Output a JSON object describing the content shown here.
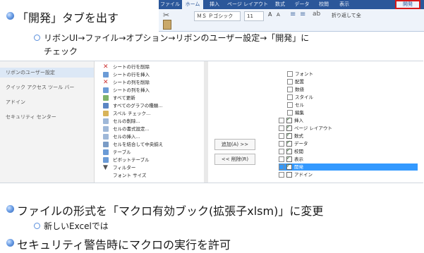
{
  "slide": {
    "bullet1": "「開発」タブを出す",
    "sub1_line1": "リボンUI→ファイル→オプション→リボンのユーザー設定→「開発」に",
    "sub1_line2": "チェック",
    "bullet2": "ファイルの形式を「マクロ有効ブック(拡張子xlsm)」に変更",
    "sub2": "新しいExcelでは",
    "bullet3": "セキュリティ警告時にマクロの実行を許可"
  },
  "ribbon": {
    "tabs": [
      "ファイル",
      "ホーム",
      "挿入",
      "ページ レイアウト",
      "数式",
      "データ",
      "校閲",
      "表示",
      "開発"
    ],
    "active_tab": "ホーム",
    "highlighted_tab": "開発",
    "font_name": "ＭＳ Ｐゴシック",
    "font_size": "11",
    "grow_font": "A",
    "shrink_font": "A",
    "wrap_text": "折り返して全",
    "highlight_color": "#d61a1a"
  },
  "dialog": {
    "sidebar": [
      "リボンのユーザー設定",
      "クイック アクセス ツール バー",
      "アドイン",
      "セキュリティ センター"
    ],
    "commands": [
      "シートの行を削除",
      "シートの行を挿入",
      "シートの列を削除",
      "シートの列を挿入",
      "すべて更新",
      "すべてのグラフの種類...",
      "スペル チェック...",
      "セルの削除...",
      "セルの書式設定...",
      "セルの挿入...",
      "セルを結合して中央揃え",
      "テーブル",
      "ピボットテーブル",
      "フィルター",
      "フォント サイズ"
    ],
    "add_button": "追加(A) >>",
    "remove_button": "<< 削除(R)",
    "tree": [
      {
        "label": "フォント",
        "level": 2,
        "check": false
      },
      {
        "label": "配置",
        "level": 2,
        "check": false
      },
      {
        "label": "数値",
        "level": 2,
        "check": false
      },
      {
        "label": "スタイル",
        "level": 2,
        "check": false
      },
      {
        "label": "セル",
        "level": 2,
        "check": false
      },
      {
        "label": "編集",
        "level": 2,
        "check": false
      },
      {
        "label": "挿入",
        "level": 1,
        "check": true
      },
      {
        "label": "ページ レイアウト",
        "level": 1,
        "check": true
      },
      {
        "label": "数式",
        "level": 1,
        "check": true
      },
      {
        "label": "データ",
        "level": 1,
        "check": true
      },
      {
        "label": "校閲",
        "level": 1,
        "check": true
      },
      {
        "label": "表示",
        "level": 1,
        "check": true
      },
      {
        "label": "開発",
        "level": 1,
        "check": true,
        "selected": true
      },
      {
        "label": "アドイン",
        "level": 1,
        "check": false
      }
    ],
    "selected_color": "#3399ff"
  }
}
